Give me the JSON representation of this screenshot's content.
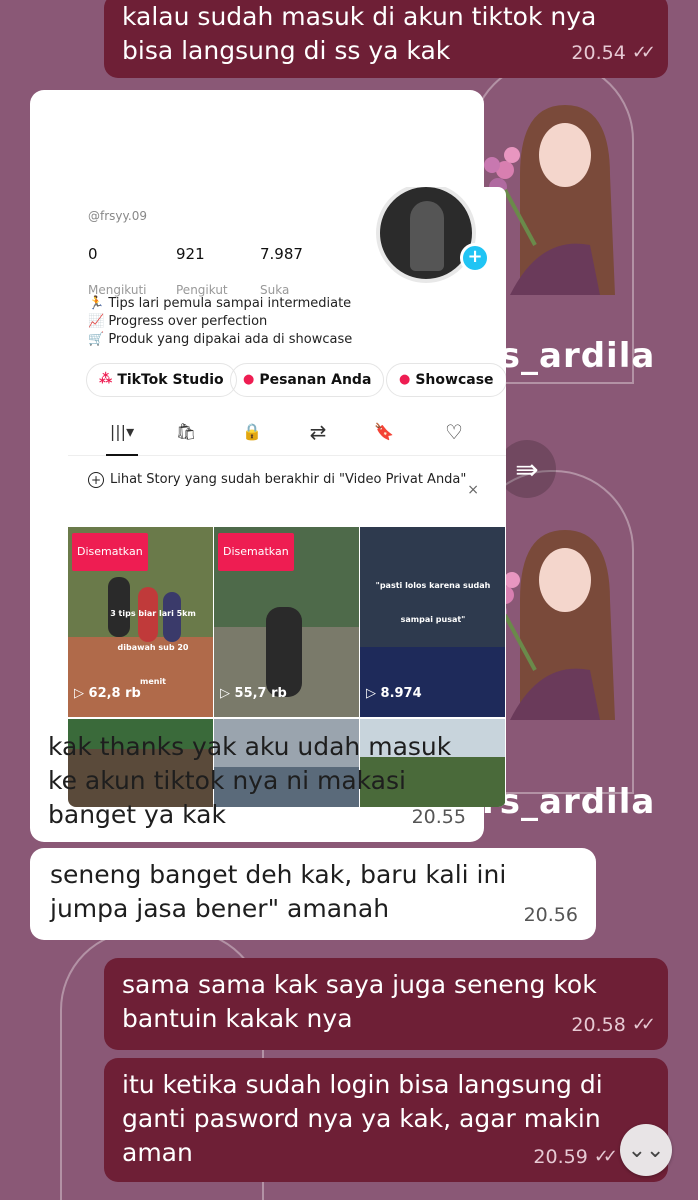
{
  "chat": {
    "messages": [
      {
        "dir": "out",
        "lines": [
          "kalau sudah masuk di akun tiktok nya",
          "bisa langsung di ss ya kak"
        ],
        "time": "20.54",
        "read": true
      },
      {
        "dir": "in",
        "lines": [
          "kak thanks yak aku udah masuk",
          "ke akun tiktok nya ni makasi",
          "banget ya kak"
        ],
        "time": "20.55",
        "read": false
      },
      {
        "dir": "in",
        "lines": [
          "seneng banget deh kak, baru kali ini",
          "jumpa jasa bener\" amanah"
        ],
        "time": "20.56",
        "read": false
      },
      {
        "dir": "out",
        "lines": [
          "sama sama kak saya juga seneng kok",
          "bantuin kakak nya"
        ],
        "time": "20.58",
        "read": true
      },
      {
        "dir": "out",
        "lines": [
          "itu ketika sudah login bisa langsung di",
          "ganti pasword nya ya kak, agar makin",
          "aman"
        ],
        "time": "20.59",
        "read": true
      }
    ],
    "scroll_down_icon": "double-chevron-down-icon",
    "forward_icon": "forward-arrow-icon"
  },
  "wallpaper": {
    "brand_text": "rs_ardila",
    "colors": {
      "background": "#8a5876",
      "hijab": "#7a4a3a",
      "flowers": "#d87fb0"
    }
  },
  "tiktok": {
    "handle": "@frsyy.09",
    "stats": [
      {
        "value": "0",
        "label": "Mengikuti"
      },
      {
        "value": "921",
        "label": "Pengikut"
      },
      {
        "value": "7.987",
        "label": "Suka"
      }
    ],
    "bio": [
      "🏃 Tips lari pemula sampai intermediate",
      "📈 Progress over perfection",
      "🛒 Produk yang dipakai ada di showcase"
    ],
    "buttons": [
      {
        "label": "TikTok Studio",
        "icon": "studio-icon"
      },
      {
        "label": "Pesanan Anda",
        "icon": "bag-icon"
      },
      {
        "label": "Showcase",
        "icon": "shop-icon"
      }
    ],
    "tabs": [
      {
        "icon": "grid-icon",
        "glyph": "|||▾"
      },
      {
        "icon": "shopping-bag-icon",
        "glyph": "🛍"
      },
      {
        "icon": "lock-icon",
        "glyph": "🔒"
      },
      {
        "icon": "repost-icon",
        "glyph": "⇄"
      },
      {
        "icon": "bookmark-icon",
        "glyph": "🔖"
      },
      {
        "icon": "heart-icon",
        "glyph": "♡"
      }
    ],
    "story_notice": "Lihat Story yang sudah berakhir di \"Video Privat Anda\"",
    "story_close": "×",
    "videos": [
      {
        "pinned": "Disematkan",
        "views": "▷ 62,8 rb",
        "overlay": "3 tips biar lari 5km dibawah sub 20 menit",
        "color": "#6a7a4a"
      },
      {
        "pinned": "Disematkan",
        "views": "▷ 55,7 rb",
        "overlay": "",
        "color": "#4e6a4a"
      },
      {
        "pinned": "",
        "views": "▷ 8.974",
        "overlay": "\"pasti lolos karena sudah sampai pusat\"",
        "color": "#2e3a4e"
      },
      {
        "pinned": "",
        "views": "",
        "overlay": "",
        "color": "#5a4a3a"
      },
      {
        "pinned": "",
        "views": "",
        "overlay": "",
        "color": "#9aa4ae"
      },
      {
        "pinned": "",
        "views": "",
        "overlay": "",
        "color": "#7a8a6a"
      }
    ]
  }
}
